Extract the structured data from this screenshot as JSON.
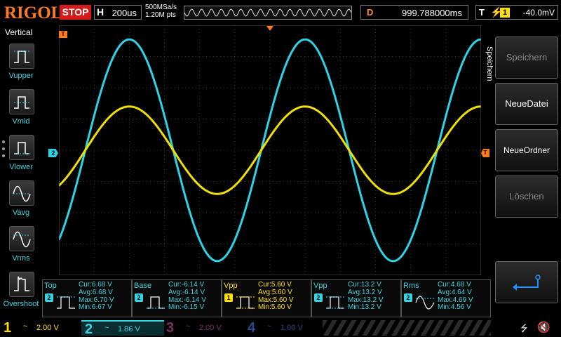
{
  "topbar": {
    "brand": "RIGOL",
    "run_state": "STOP",
    "horizontal": {
      "label": "H",
      "value": "200us"
    },
    "sample_rate": "500MSa/s",
    "memory_depth": "1.20M pts",
    "delay": {
      "label": "D",
      "value": "999.788000ms"
    },
    "trigger": {
      "label": "T",
      "source": "1",
      "level": "-40.0mV",
      "slope_icon": "rising-edge-icon"
    }
  },
  "left_menu": {
    "title": "Vertical",
    "items": [
      {
        "label": "Vupper",
        "icon": "pulse-upper-icon"
      },
      {
        "label": "Vmid",
        "icon": "pulse-mid-icon"
      },
      {
        "label": "Vlower",
        "icon": "pulse-lower-icon"
      },
      {
        "label": "Vavg",
        "icon": "sine-avg-icon"
      },
      {
        "label": "Vrms",
        "icon": "sine-rms-icon"
      },
      {
        "label": "Overshoot",
        "icon": "overshoot-icon"
      }
    ]
  },
  "markers": {
    "ch2_ref": "2",
    "trigger_pos": "T",
    "trigger_level": "T"
  },
  "right_menu": {
    "title": "Speichern",
    "buttons": [
      {
        "label": "Speichern",
        "enabled": false
      },
      {
        "label": "NeueDatei",
        "enabled": true
      },
      {
        "label": "NeueOrdner",
        "enabled": true
      },
      {
        "label": "Löschen",
        "enabled": false
      }
    ],
    "enter_icon": "enter-icon"
  },
  "measurements": [
    {
      "name": "Top",
      "channel": "2",
      "color": "#3ad4e0",
      "cur": "Cur:6.68 V",
      "avg": "Avg:6.68 V",
      "max": "Max:6.70 V",
      "min": "Min:6.67 V"
    },
    {
      "name": "Base",
      "channel": "2",
      "color": "#3ad4e0",
      "cur": "Cur:-6.14 V",
      "avg": "Avg:-6.14 V",
      "max": "Max:-6.14 V",
      "min": "Min:-6.15 V"
    },
    {
      "name": "Vpp",
      "channel": "1",
      "color": "#ffe000",
      "cur": "Cur:5.60 V",
      "avg": "Avg:5.60 V",
      "max": "Max:5.60 V",
      "min": "Min:5.60 V"
    },
    {
      "name": "Vpp",
      "channel": "2",
      "color": "#3ad4e0",
      "cur": "Cur:13.2 V",
      "avg": "Avg:13.2 V",
      "max": "Max:13.2 V",
      "min": "Min:13.2 V"
    },
    {
      "name": "Rms",
      "channel": "2",
      "color": "#3ad4e0",
      "cur": "Cur:4.68 V",
      "avg": "Avg:4.64 V",
      "max": "Max:4.69 V",
      "min": "Min:4.56 V"
    }
  ],
  "channels": [
    {
      "num": "1",
      "coupling": "~",
      "scale": "2.00 V",
      "color": "#ffe000",
      "active": false
    },
    {
      "num": "2",
      "coupling": "~",
      "scale": "1.86 V",
      "color": "#3ad4e0",
      "active": true
    },
    {
      "num": "3",
      "coupling": "~",
      "scale": "2.00 V",
      "color": "#7a2f6b",
      "active": false
    },
    {
      "num": "4",
      "coupling": "~",
      "scale": "1.00 V",
      "color": "#2a4a8a",
      "active": false
    }
  ],
  "status_icons": {
    "usb": "usb-icon",
    "speaker": "speaker-mute-icon"
  },
  "chart_data": {
    "type": "line",
    "xlabel": "",
    "ylabel": "",
    "grid": true,
    "x_divisions": 12,
    "y_divisions": 8,
    "series": [
      {
        "name": "1",
        "color": "#ffe000",
        "volts_per_div": 2.0,
        "vpp": 5.6,
        "offset_div": 0,
        "periods": 2.4,
        "phase": 0.0
      },
      {
        "name": "2",
        "color": "#3ad4e0",
        "volts_per_div": 1.86,
        "vpp": 13.2,
        "offset_div": 0,
        "periods": 2.4,
        "phase": 0.0
      }
    ]
  }
}
